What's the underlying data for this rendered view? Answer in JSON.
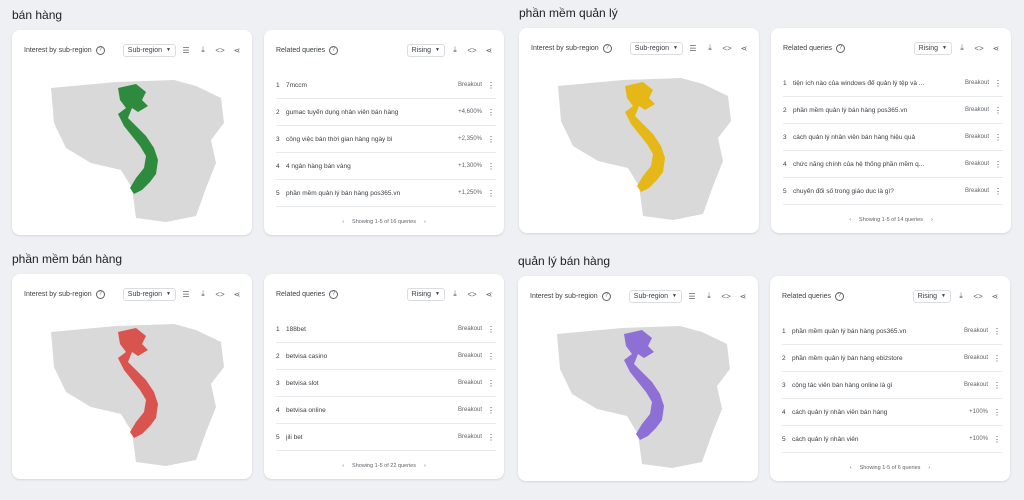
{
  "quadrants": [
    {
      "title": "bán hàng",
      "map": {
        "heading": "Interest by sub-region",
        "select": "Sub-region",
        "color": "#2e8b3d"
      },
      "queries": {
        "heading": "Related queries",
        "select": "Rising",
        "rows": [
          {
            "n": "1",
            "q": "7mccm",
            "v": "Breakout"
          },
          {
            "n": "2",
            "q": "gumac tuyển dụng nhân viên bán hàng",
            "v": "+4,600%"
          },
          {
            "n": "3",
            "q": "công việc bán thời gian hàng ngày bì",
            "v": "+2,350%"
          },
          {
            "n": "4",
            "q": "4 ngân hàng bán vàng",
            "v": "+1,300%"
          },
          {
            "n": "5",
            "q": "phần mềm quản lý bán hàng pos365.vn",
            "v": "+1,250%"
          }
        ],
        "pager": "Showing 1-5 of 16 queries"
      }
    },
    {
      "title": "phần mềm quản lý",
      "map": {
        "heading": "Interest by sub-region",
        "select": "Sub-region",
        "color": "#e6b817"
      },
      "queries": {
        "heading": "Related queries",
        "select": "Rising",
        "rows": [
          {
            "n": "1",
            "q": "tiện ích nào của windows để quản lý tệp và ...",
            "v": "Breakout"
          },
          {
            "n": "2",
            "q": "phần mềm quản lý bán hàng pos365.vn",
            "v": "Breakout"
          },
          {
            "n": "3",
            "q": "cách quản lý nhân viên bán hàng hiệu quả",
            "v": "Breakout"
          },
          {
            "n": "4",
            "q": "chức năng chính của hệ thống phần mềm q...",
            "v": "Breakout"
          },
          {
            "n": "5",
            "q": "chuyển đổi số trong giáo dục là gì?",
            "v": "Breakout"
          }
        ],
        "pager": "Showing 1-5 of 14 queries"
      }
    },
    {
      "title": "phần mềm bán hàng",
      "map": {
        "heading": "Interest by sub-region",
        "select": "Sub-region",
        "color": "#d9534f"
      },
      "queries": {
        "heading": "Related queries",
        "select": "Rising",
        "rows": [
          {
            "n": "1",
            "q": "188bet",
            "v": "Breakout"
          },
          {
            "n": "2",
            "q": "betvisa casino",
            "v": "Breakout"
          },
          {
            "n": "3",
            "q": "betvisa slot",
            "v": "Breakout"
          },
          {
            "n": "4",
            "q": "betvisa online",
            "v": "Breakout"
          },
          {
            "n": "5",
            "q": "jili bet",
            "v": "Breakout"
          }
        ],
        "pager": "Showing 1-5 of 22 queries"
      }
    },
    {
      "title": "quản lý bán hàng",
      "map": {
        "heading": "Interest by sub-region",
        "select": "Sub-region",
        "color": "#8e6fd6"
      },
      "queries": {
        "heading": "Related queries",
        "select": "Rising",
        "rows": [
          {
            "n": "1",
            "q": "phần mềm quản lý bán hàng pos365.vn",
            "v": "Breakout"
          },
          {
            "n": "2",
            "q": "phần mềm quản lý bán hàng ebizstore",
            "v": "Breakout"
          },
          {
            "n": "3",
            "q": "cộng tác viên bán hàng online là gì",
            "v": "Breakout"
          },
          {
            "n": "4",
            "q": "cách quản lý nhân viên bán hàng",
            "v": "+100%"
          },
          {
            "n": "5",
            "q": "cách quản lý nhân viên",
            "v": "+100%"
          }
        ],
        "pager": "Showing 1-5 of 6 queries"
      }
    }
  ]
}
